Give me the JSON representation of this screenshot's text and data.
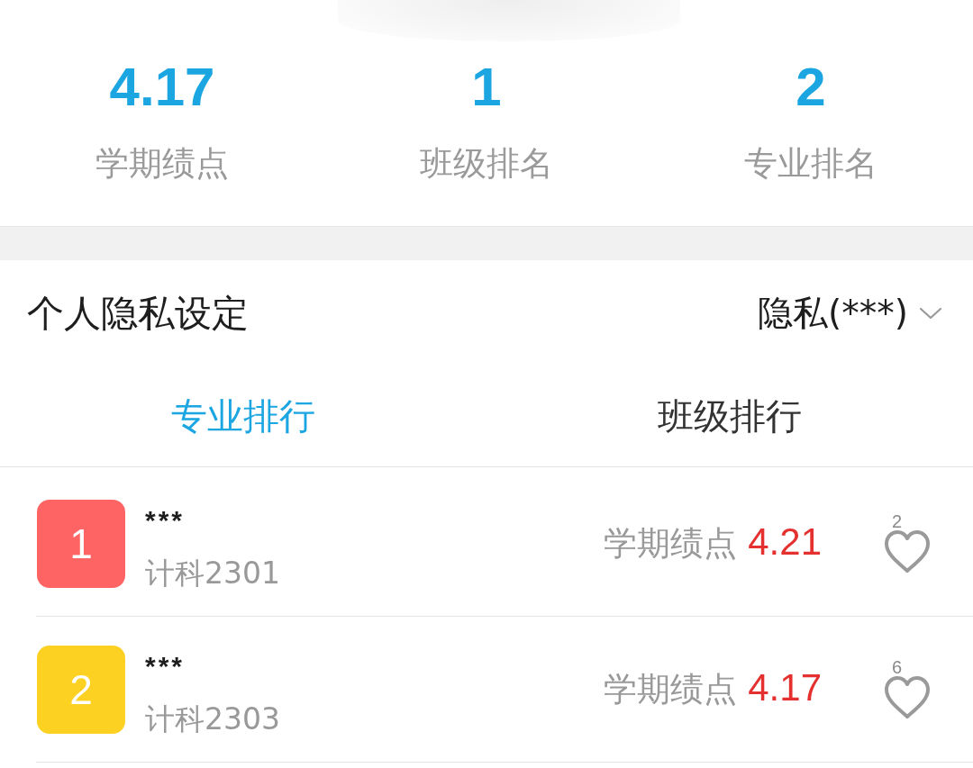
{
  "stats": [
    {
      "value": "4.17",
      "label": "学期绩点"
    },
    {
      "value": "1",
      "label": "班级排名"
    },
    {
      "value": "2",
      "label": "专业排名"
    }
  ],
  "privacy": {
    "label": "个人隐私设定",
    "value": "隐私(***)"
  },
  "tabs": [
    {
      "label": "专业排行",
      "selected": true
    },
    {
      "label": "班级排行",
      "selected": false
    }
  ],
  "rankings": [
    {
      "rank": "1",
      "color": "#fe6464",
      "name": "***",
      "class": "计科2301",
      "metric_label": "学期绩点",
      "metric_value": "4.21",
      "likes": "2"
    },
    {
      "rank": "2",
      "color": "#fdd122",
      "name": "***",
      "class": "计科2303",
      "metric_label": "学期绩点",
      "metric_value": "4.17",
      "likes": "6"
    }
  ]
}
